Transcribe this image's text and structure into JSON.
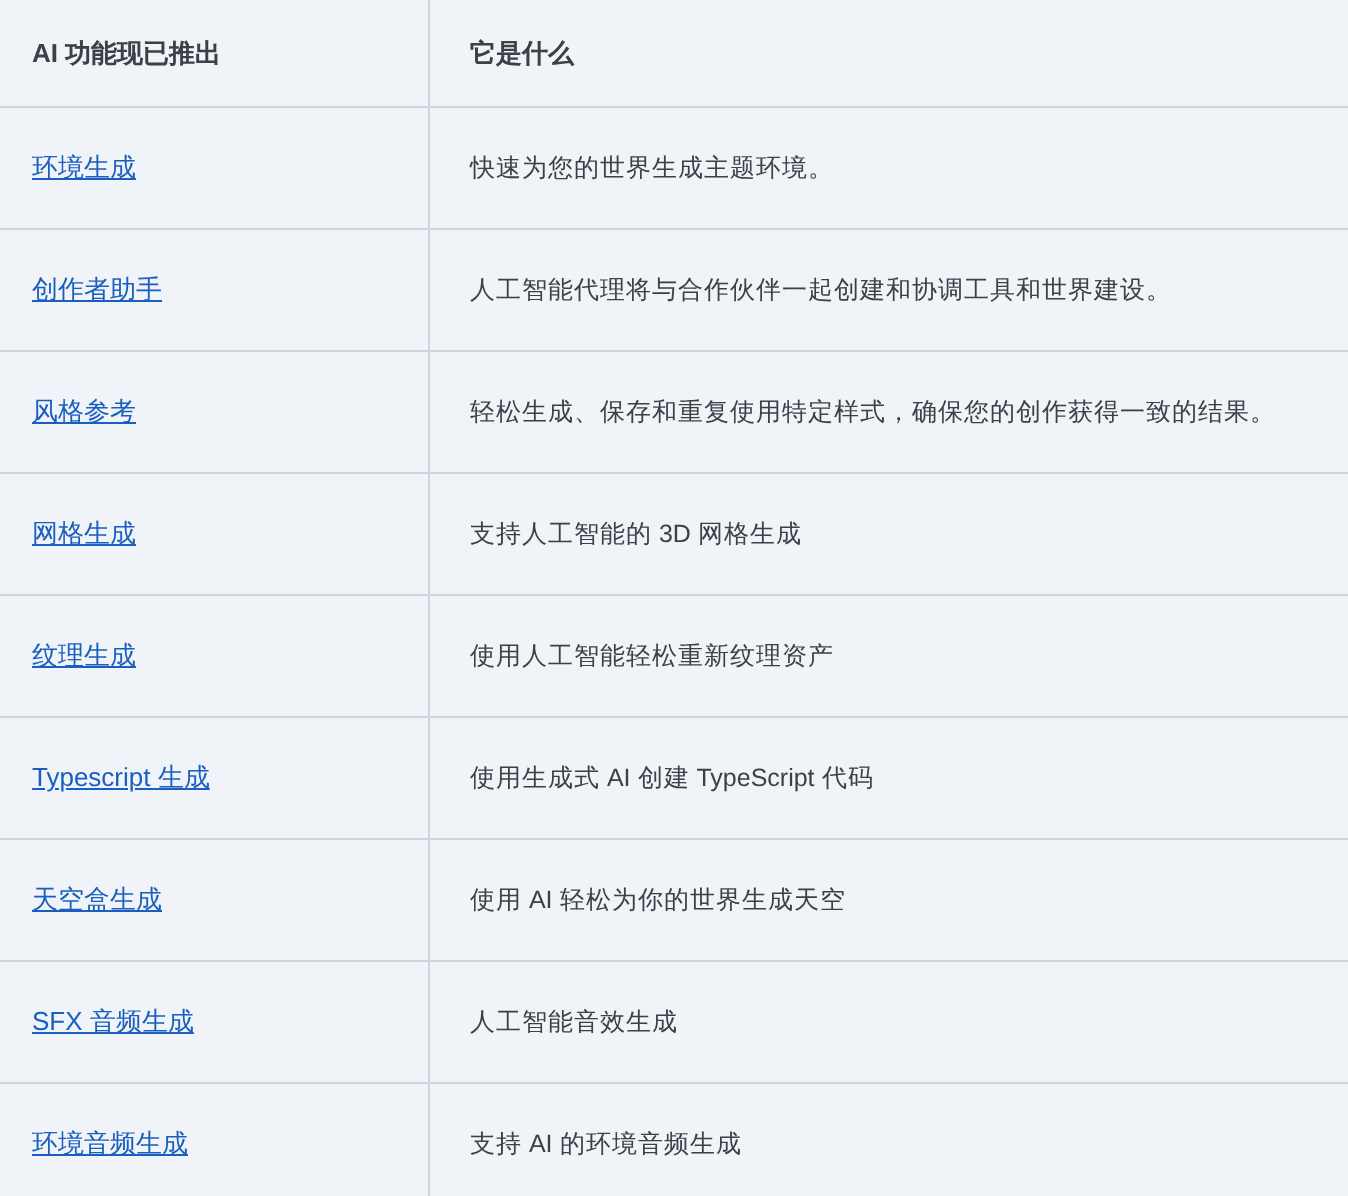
{
  "table": {
    "columns": [
      "AI 功能现已推出",
      "它是什么"
    ],
    "rows": [
      {
        "feature": "环境生成",
        "description": "快速为您的世界生成主题环境。"
      },
      {
        "feature": "创作者助手",
        "description": "人工智能代理将与合作伙伴一起创建和协调工具和世界建设。"
      },
      {
        "feature": "风格参考",
        "description": "轻松生成、保存和重复使用特定样式，确保您的创作获得一致的结果。"
      },
      {
        "feature": "网格生成",
        "description": "支持人工智能的 3D 网格生成"
      },
      {
        "feature": "纹理生成",
        "description": "使用人工智能轻松重新纹理资产"
      },
      {
        "feature": "Typescript 生成",
        "description": "使用生成式 AI 创建 TypeScript 代码"
      },
      {
        "feature": "天空盒生成",
        "description": "使用 AI 轻松为你的世界生成天空"
      },
      {
        "feature": "SFX 音频生成",
        "description": "人工智能音效生成"
      },
      {
        "feature": "环境音频生成",
        "description": "支持 AI 的环境音频生成"
      }
    ]
  }
}
